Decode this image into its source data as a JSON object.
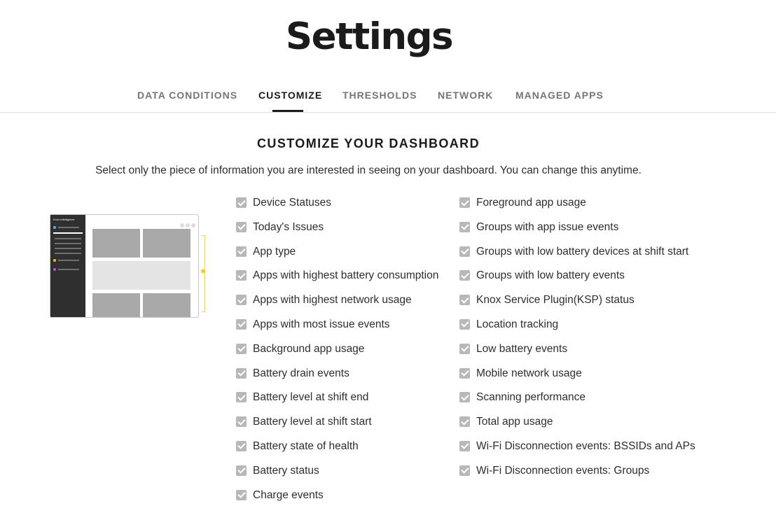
{
  "page": {
    "title": "Settings"
  },
  "tabs": [
    {
      "label": "DATA CONDITIONS",
      "active": false
    },
    {
      "label": "CUSTOMIZE",
      "active": true
    },
    {
      "label": "THRESHOLDS",
      "active": false
    },
    {
      "label": "NETWORK",
      "active": false
    },
    {
      "label": "MANAGED APPS",
      "active": false
    }
  ],
  "customize": {
    "heading": "CUSTOMIZE YOUR DASHBOARD",
    "description": "Select only the piece of information you are interested in seeing on your dashboard. You can change this anytime.",
    "illustration_title": "Knox Intelligence",
    "column1": [
      {
        "label": "Device Statuses",
        "checked": true
      },
      {
        "label": "Today's Issues",
        "checked": true
      },
      {
        "label": "App type",
        "checked": true
      },
      {
        "label": "Apps with highest battery consumption",
        "checked": true
      },
      {
        "label": "Apps with highest network usage",
        "checked": true
      },
      {
        "label": "Apps with most issue events",
        "checked": true
      },
      {
        "label": "Background app usage",
        "checked": true
      },
      {
        "label": "Battery drain events",
        "checked": true
      },
      {
        "label": "Battery level at shift end",
        "checked": true
      },
      {
        "label": "Battery level at shift start",
        "checked": true
      },
      {
        "label": "Battery state of health",
        "checked": true
      },
      {
        "label": "Battery status",
        "checked": true
      },
      {
        "label": "Charge events",
        "checked": true
      }
    ],
    "column2": [
      {
        "label": "Foreground app usage",
        "checked": true
      },
      {
        "label": "Groups with app issue events",
        "checked": true
      },
      {
        "label": "Groups with low battery devices at shift start",
        "checked": true
      },
      {
        "label": "Groups with low battery events",
        "checked": true
      },
      {
        "label": "Knox Service Plugin(KSP) status",
        "checked": true
      },
      {
        "label": "Location tracking",
        "checked": true
      },
      {
        "label": "Low battery events",
        "checked": true
      },
      {
        "label": "Mobile network usage",
        "checked": true
      },
      {
        "label": "Scanning performance",
        "checked": true
      },
      {
        "label": "Total app usage",
        "checked": true
      },
      {
        "label": "Wi-Fi Disconnection events: BSSIDs and APs",
        "checked": true
      },
      {
        "label": "Wi-Fi Disconnection events: Groups",
        "checked": true
      }
    ]
  },
  "colors": {
    "checkbox": "#b8b8b8",
    "tab_active": "#1b1b1b",
    "tab_inactive": "#757575",
    "accent_star": "#f2c200"
  }
}
